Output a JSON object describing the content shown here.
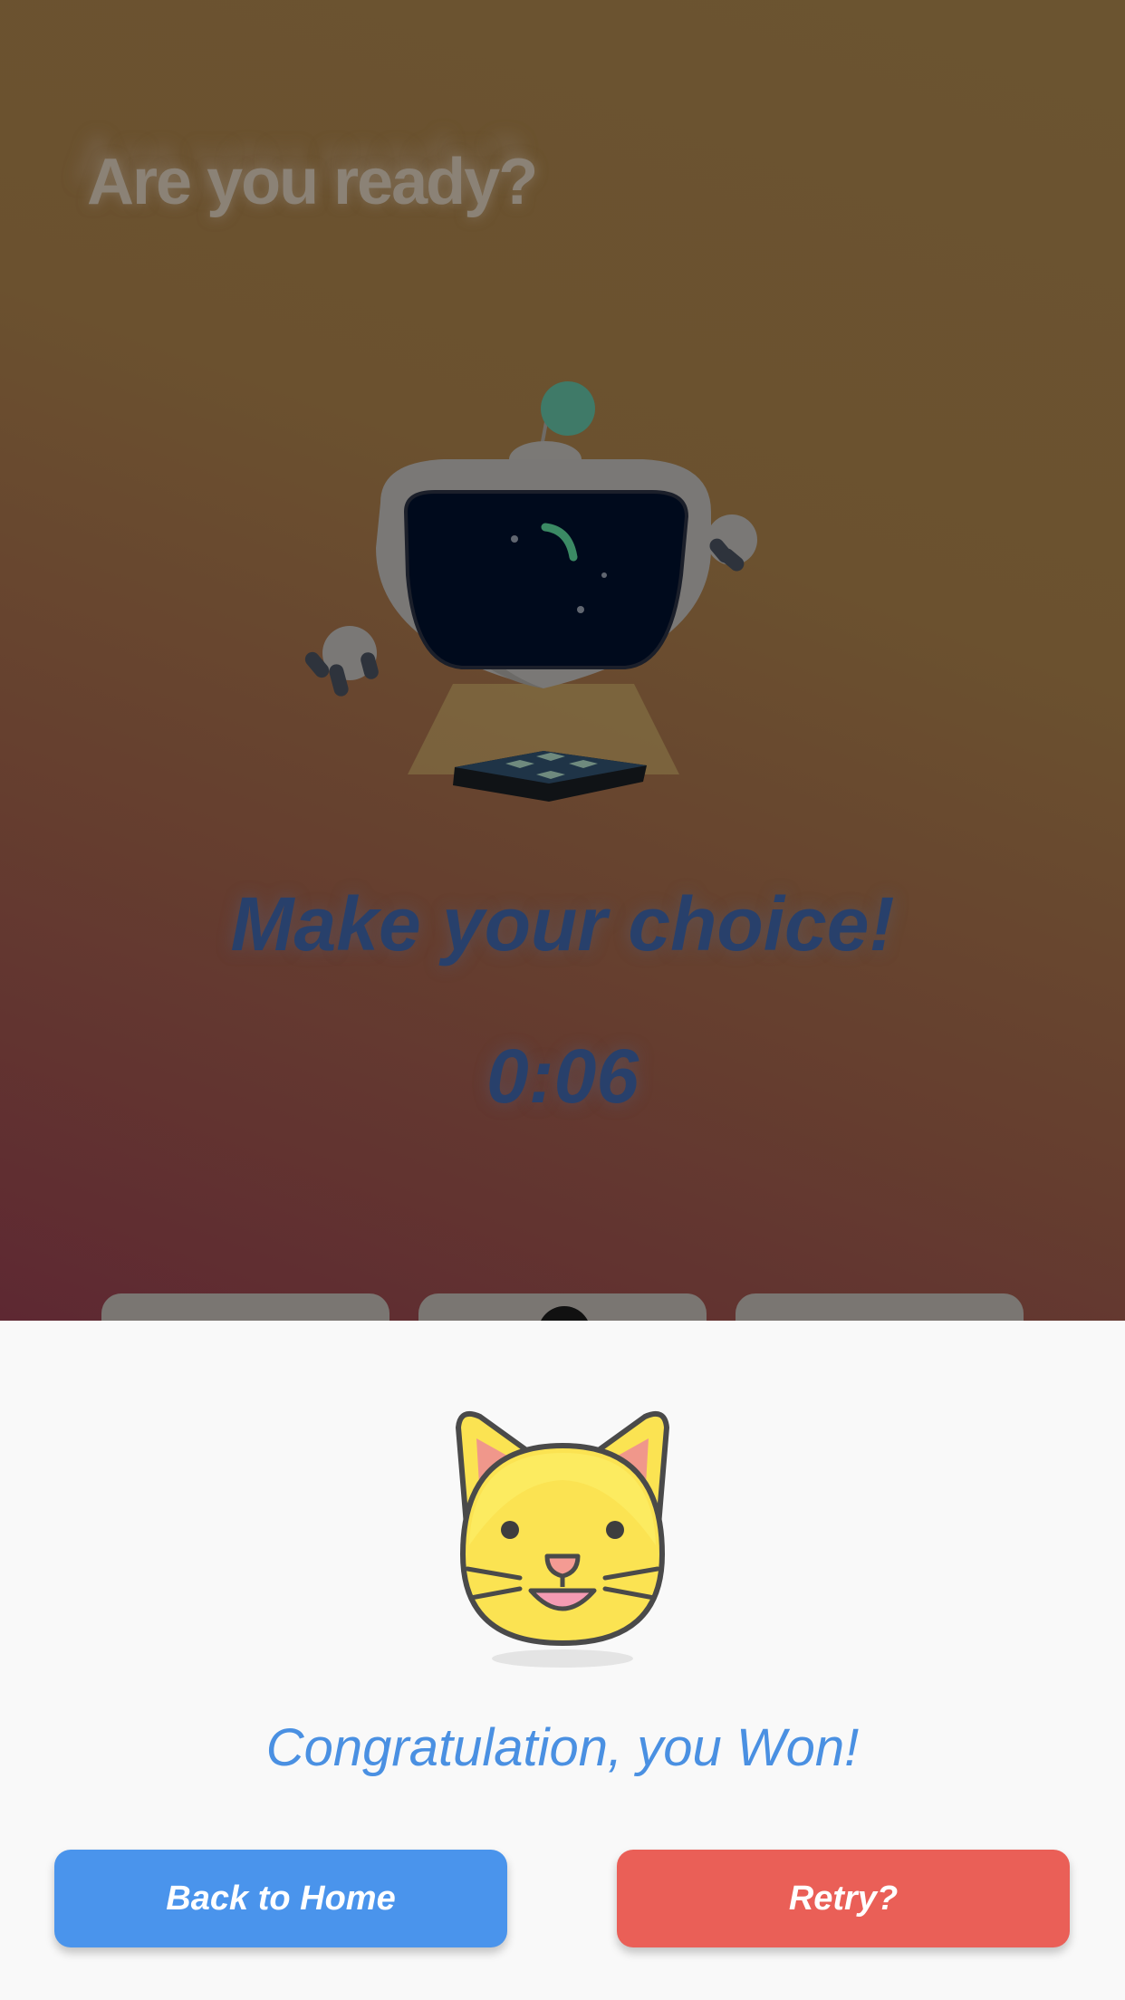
{
  "game": {
    "ready_title": "Are you ready?",
    "prompt": "Make your choice!",
    "timer": "0:06"
  },
  "result": {
    "message": "Congratulation, you Won!",
    "icon": "grinning-cat-icon",
    "buttons": {
      "home_label": "Back to Home",
      "retry_label": "Retry?"
    }
  },
  "colors": {
    "background_top": "#6b5430",
    "background_bottom": "#5e2832",
    "prompt_text": "#28406b",
    "result_text": "#4a90e2",
    "home_button": "#4a94ec",
    "retry_button": "#ea5f57",
    "sheet_background": "#f9f9f9"
  }
}
